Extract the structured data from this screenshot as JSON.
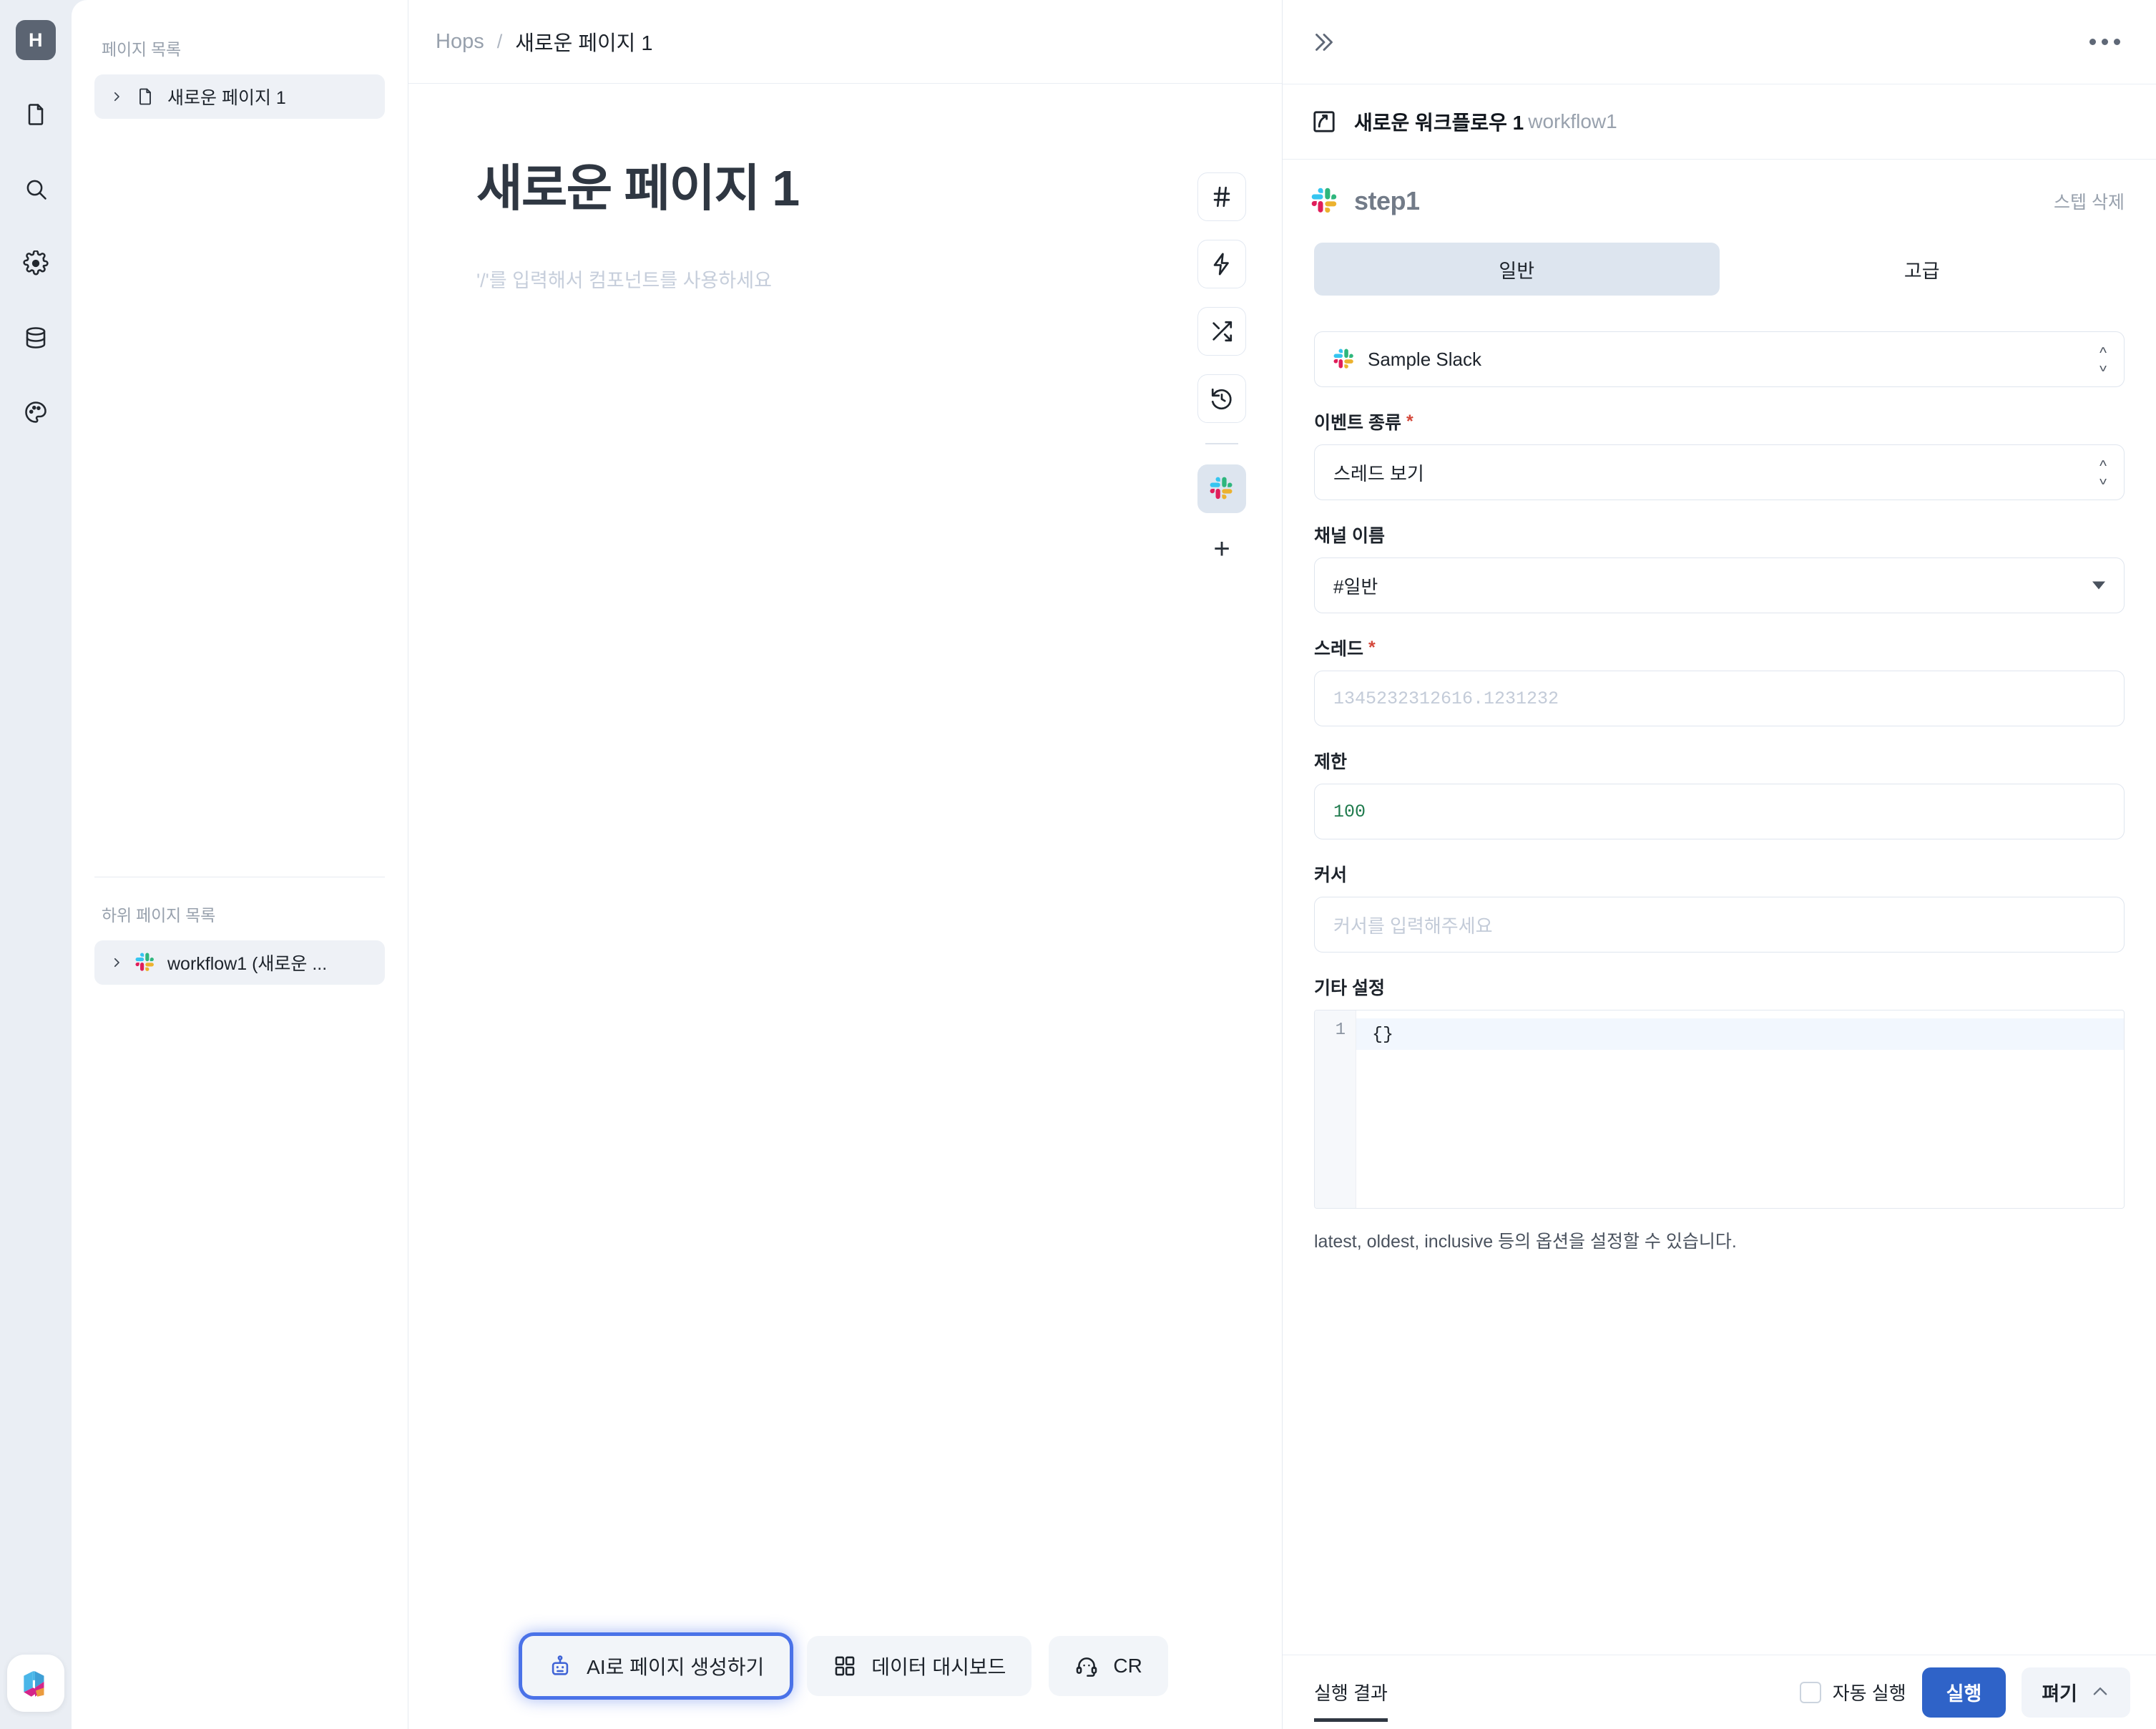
{
  "rail": {
    "logo_label": "H",
    "items": [
      {
        "name": "page-icon",
        "title": "페이지"
      },
      {
        "name": "search-icon",
        "title": "검색"
      },
      {
        "name": "gear-icon",
        "title": "설정"
      },
      {
        "name": "database-icon",
        "title": "데이터"
      },
      {
        "name": "palette-icon",
        "title": "테마"
      }
    ]
  },
  "sidebar": {
    "pages_title": "페이지 목록",
    "pages": [
      {
        "label": "새로운 페이지 1",
        "icon": "document-icon",
        "active": true
      }
    ],
    "subpages_title": "하위 페이지 목록",
    "subpages": [
      {
        "label": "workflow1 (새로운 ...",
        "icon": "slack-icon",
        "active": true
      }
    ]
  },
  "breadcrumb": {
    "root": "Hops",
    "separator": "/",
    "current": "새로운 페이지 1"
  },
  "canvas": {
    "page_title": "새로운 페이지 1",
    "placeholder_hint": "'/'를 입력해서 컴포넌트를 사용하세요",
    "tools": [
      {
        "name": "hash-icon",
        "glyph": "#",
        "selected": false
      },
      {
        "name": "lightning-icon",
        "glyph": "⚡",
        "selected": false
      },
      {
        "name": "shuffle-icon",
        "glyph": "⤨",
        "selected": false
      },
      {
        "name": "history-icon",
        "glyph": "⟲",
        "selected": false
      },
      {
        "name": "slack-icon",
        "glyph": "slack",
        "selected": true
      }
    ],
    "add_tool_label": "+"
  },
  "bottom_buttons": [
    {
      "label": "AI로 페이지 생성하기",
      "icon": "robot-icon",
      "highlighted": true
    },
    {
      "label": "데이터 대시보드",
      "icon": "dashboard-icon",
      "highlighted": false
    },
    {
      "label": "CR",
      "icon": "headset-icon",
      "highlighted": false
    }
  ],
  "right_panel": {
    "collapse_label": "»",
    "more_label": "…",
    "workflow": {
      "icon": "workflow-icon",
      "name": "새로운 워크플로우 1",
      "slug": "workflow1"
    },
    "step": {
      "icon": "slack-icon",
      "name": "step1",
      "delete_label": "스텝 삭제"
    },
    "tabs": [
      {
        "label": "일반",
        "active": true
      },
      {
        "label": "고급",
        "active": false
      }
    ],
    "connection": {
      "icon": "slack-icon",
      "value": "Sample Slack"
    },
    "fields": [
      {
        "key": "event_type",
        "label": "이벤트 종류",
        "required": true,
        "control": "select",
        "value": "스레드 보기"
      },
      {
        "key": "channel_name",
        "label": "채널 이름",
        "required": false,
        "control": "dropdown",
        "value": "#일반"
      },
      {
        "key": "thread",
        "label": "스레드",
        "required": true,
        "control": "text",
        "value": "",
        "placeholder": "1345232312616.1231232"
      },
      {
        "key": "limit",
        "label": "제한",
        "required": false,
        "control": "code-value",
        "value": "100"
      },
      {
        "key": "cursor",
        "label": "커서",
        "required": false,
        "control": "text",
        "value": "",
        "placeholder": "커서를 입력해주세요"
      }
    ],
    "extra_settings": {
      "label": "기타 설정",
      "line_number": "1",
      "code": "{}",
      "help": "latest, oldest, inclusive 등의 옵션을 설정할 수 있습니다."
    },
    "footer": {
      "result_tab": "실행 결과",
      "auto_run_label": "자동 실행",
      "auto_run_checked": false,
      "run_label": "실행",
      "expand_label": "펴기"
    }
  },
  "colors": {
    "accent_blue": "#2f63c8",
    "highlight_blue": "#4a72e8",
    "panel_bg": "#ffffff",
    "app_bg": "#eaeef4",
    "muted_text": "#98a1ad",
    "required_red": "#d4483b",
    "code_green": "#1f7a4d"
  }
}
